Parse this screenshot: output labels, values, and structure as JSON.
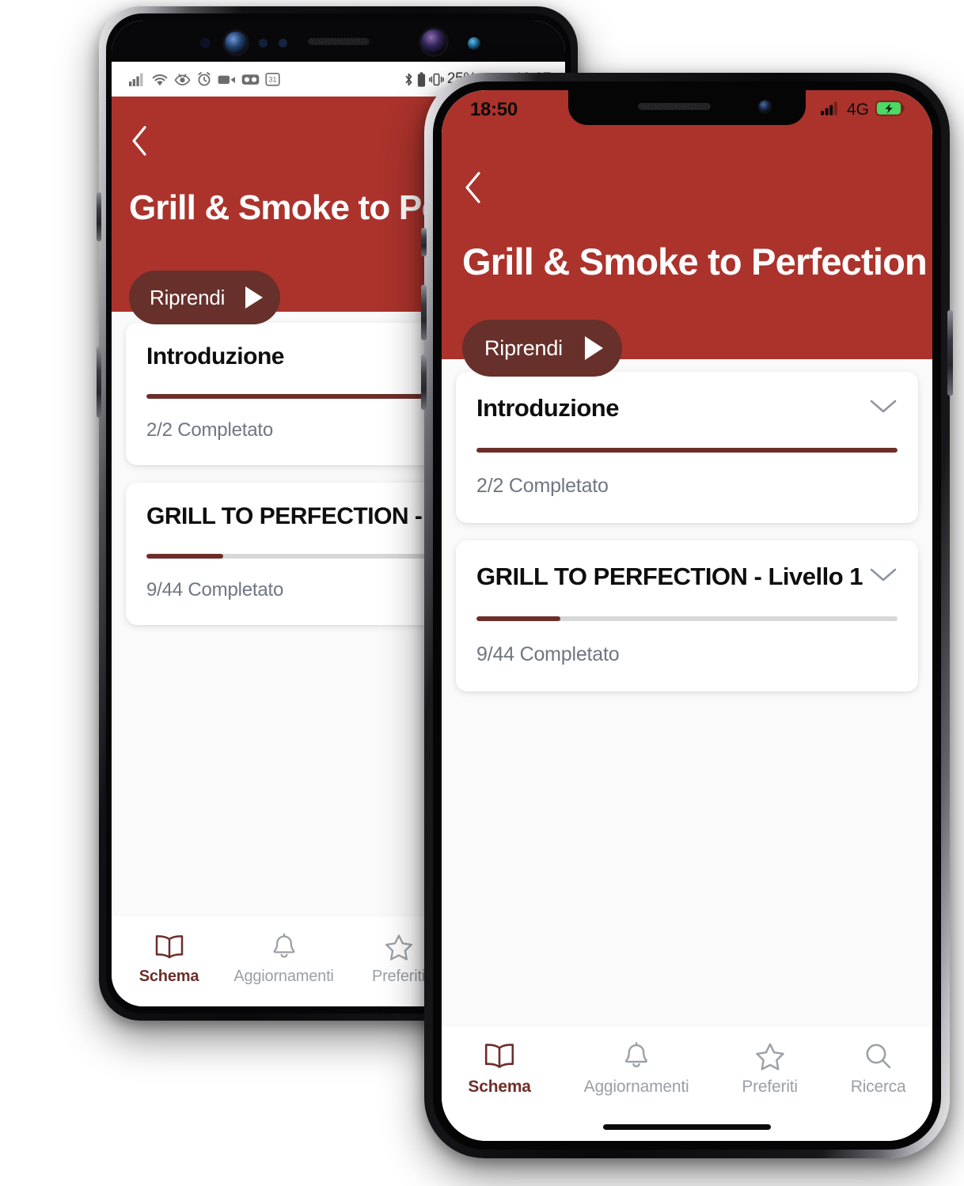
{
  "android": {
    "status_bar": {
      "time": "19:07",
      "battery_percent": "25%",
      "left_icons": [
        "signal-icon",
        "wifi-icon",
        "eye-icon",
        "alarm-icon",
        "video-camera-icon",
        "vr-icon",
        "calendar-icon"
      ],
      "right_icons": [
        "bluetooth-icon",
        "battery-small-icon",
        "vibrate-icon",
        "battery-icon"
      ]
    },
    "header": {
      "back_icon": "chevron-left-icon",
      "title": "Grill & Smoke to Perfection",
      "resume_label": "Riprendi",
      "play_icon": "play-icon"
    },
    "sections": [
      {
        "title": "Introduzione",
        "progress_label": "2/2 Completato",
        "completed": 2,
        "total": 2,
        "percent": 100,
        "chevron": "chevron-down-icon"
      },
      {
        "title": "GRILL TO PERFECTION - Livello 1",
        "progress_label": "9/44 Completato",
        "completed": 9,
        "total": 44,
        "percent": 20,
        "chevron": "chevron-down-icon"
      }
    ],
    "tabs": [
      {
        "label": "Schema",
        "icon": "book-icon",
        "active": true
      },
      {
        "label": "Aggiornamenti",
        "icon": "bell-icon",
        "active": false
      },
      {
        "label": "Preferiti",
        "icon": "star-icon",
        "active": false
      },
      {
        "label": "Ricerca",
        "icon": "search-icon",
        "active": false
      }
    ]
  },
  "ios": {
    "status_bar": {
      "time": "18:50",
      "network": "4G",
      "signal_icon": "signal-bars-icon",
      "battery_icon": "battery-charging-icon"
    },
    "header": {
      "back_icon": "chevron-left-icon",
      "title": "Grill & Smoke to Perfection",
      "resume_label": "Riprendi",
      "play_icon": "play-icon"
    },
    "sections": [
      {
        "title": "Introduzione",
        "progress_label": "2/2 Completato",
        "completed": 2,
        "total": 2,
        "percent": 100,
        "chevron": "chevron-down-icon"
      },
      {
        "title": "GRILL TO PERFECTION - Livello 1",
        "progress_label": "9/44 Completato",
        "completed": 9,
        "total": 44,
        "percent": 20,
        "chevron": "chevron-down-icon"
      }
    ],
    "tabs": [
      {
        "label": "Schema",
        "icon": "book-icon",
        "active": true
      },
      {
        "label": "Aggiornamenti",
        "icon": "bell-icon",
        "active": false
      },
      {
        "label": "Preferiti",
        "icon": "star-icon",
        "active": false
      },
      {
        "label": "Ricerca",
        "icon": "search-icon",
        "active": false
      }
    ]
  },
  "colors": {
    "header_red": "#ab332c",
    "accent_dark_red": "#6d2e2a",
    "button_maroon": "#67302b",
    "page_background": "#fafafa",
    "progress_track": "#d8d8d8",
    "muted_text": "#6f7682",
    "inactive_tab": "#9aa0a6",
    "battery_green": "#4cd964"
  }
}
